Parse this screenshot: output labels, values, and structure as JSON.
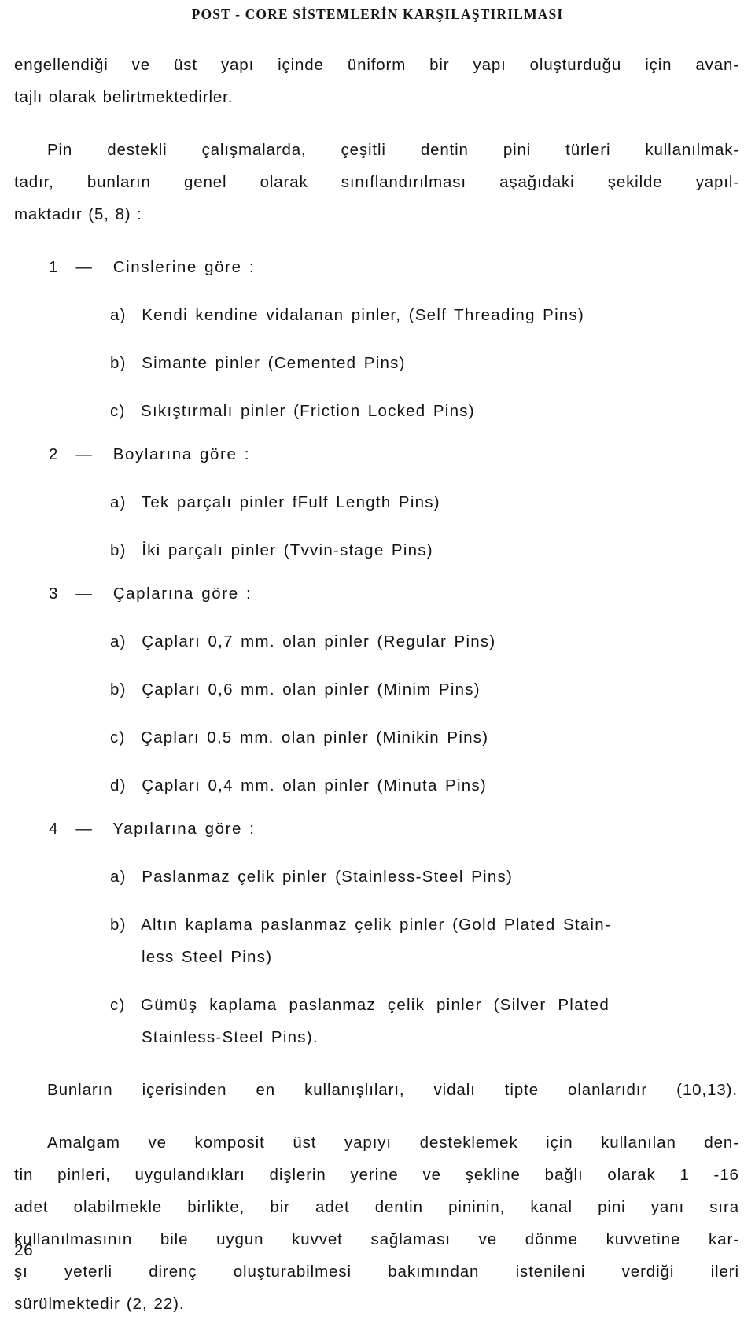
{
  "document": {
    "running_head": "POST - CORE SİSTEMLERİN KARŞILAŞTIRILMASI",
    "page_number": "26",
    "language": "tr"
  },
  "paragraphs": {
    "continued_para_line1": "engellendiği ve üst yapı içinde üniform bir yapı oluşturduğu için avan-",
    "continued_para_line2": "tajlı olarak belirtmektedirler.",
    "intro_line1": "Pin destekli çalışmalarda, çeşitli dentin pini türleri kullanılmak-",
    "intro_line2": "tadır, bunların genel olarak sınıflandırılması aşağıdaki şekilde yapıl-",
    "intro_line3": "maktadır (5, 8) :"
  },
  "classification": {
    "groups": [
      {
        "number": "1",
        "dash": "—",
        "title": "Cinslerine göre :",
        "items": [
          {
            "marker": "a)",
            "text": "Kendi kendine vidalanan pinler, (Self Threading Pins)"
          },
          {
            "marker": "b)",
            "text": "Simante pinler (Cemented Pins)"
          },
          {
            "marker": "c)",
            "text": "Sıkıştırmalı pinler (Friction Locked Pins)"
          }
        ]
      },
      {
        "number": "2",
        "dash": "—",
        "title": "Boylarına göre :",
        "items": [
          {
            "marker": "a)",
            "text": "Tek parçalı pinler fFulf Length Pins)"
          },
          {
            "marker": "b)",
            "text": "İki parçalı pinler (Tvvin-stage Pins)"
          }
        ]
      },
      {
        "number": "3",
        "dash": "—",
        "title": "Çaplarına göre :",
        "items": [
          {
            "marker": "a)",
            "text": "Çapları 0,7 mm. olan pinler (Regular Pins)"
          },
          {
            "marker": "b)",
            "text": "Çapları 0,6 mm. olan pinler (Minim Pins)"
          },
          {
            "marker": "c)",
            "text": "Çapları 0,5 mm. olan pinler (Minikin Pins)"
          },
          {
            "marker": "d)",
            "text": "Çapları 0,4 mm. olan pinler (Minuta Pins)"
          }
        ]
      },
      {
        "number": "4",
        "dash": "—",
        "title": "Yapılarına göre :",
        "items": [
          {
            "marker": "a)",
            "text": "Paslanmaz çelik pinler (Stainless-Steel Pins)"
          },
          {
            "marker": "b)",
            "text": "Altın kaplama paslanmaz çelik pinler (Gold Plated Stain-",
            "continuation": "less Steel Pins)"
          },
          {
            "marker": "c)",
            "text": "Gümüş kaplama paslanmaz çelik pinler   (Silver Plated",
            "continuation": "Stainless-Steel Pins)."
          }
        ]
      }
    ]
  },
  "closing": {
    "note": "Bunların içerisinden en kullanışlıları, vidalı tipte olanlarıdır (10,13).",
    "final_lines": [
      "Amalgam ve komposit üst yapıyı desteklemek için kullanılan den-",
      "tin pinleri, uygulandıkları dişlerin yerine ve şekline bağlı olarak 1 -16",
      "adet olabilmekle birlikte, bir adet dentin pininin, kanal pini yanı sıra",
      "kullanılmasının bile uygun kuvvet sağlaması ve dönme kuvvetine kar-",
      "şı yeterli direnç oluşturabilmesi bakımından istenileni verdiği ileri",
      "sürülmektedir (2, 22)."
    ]
  }
}
